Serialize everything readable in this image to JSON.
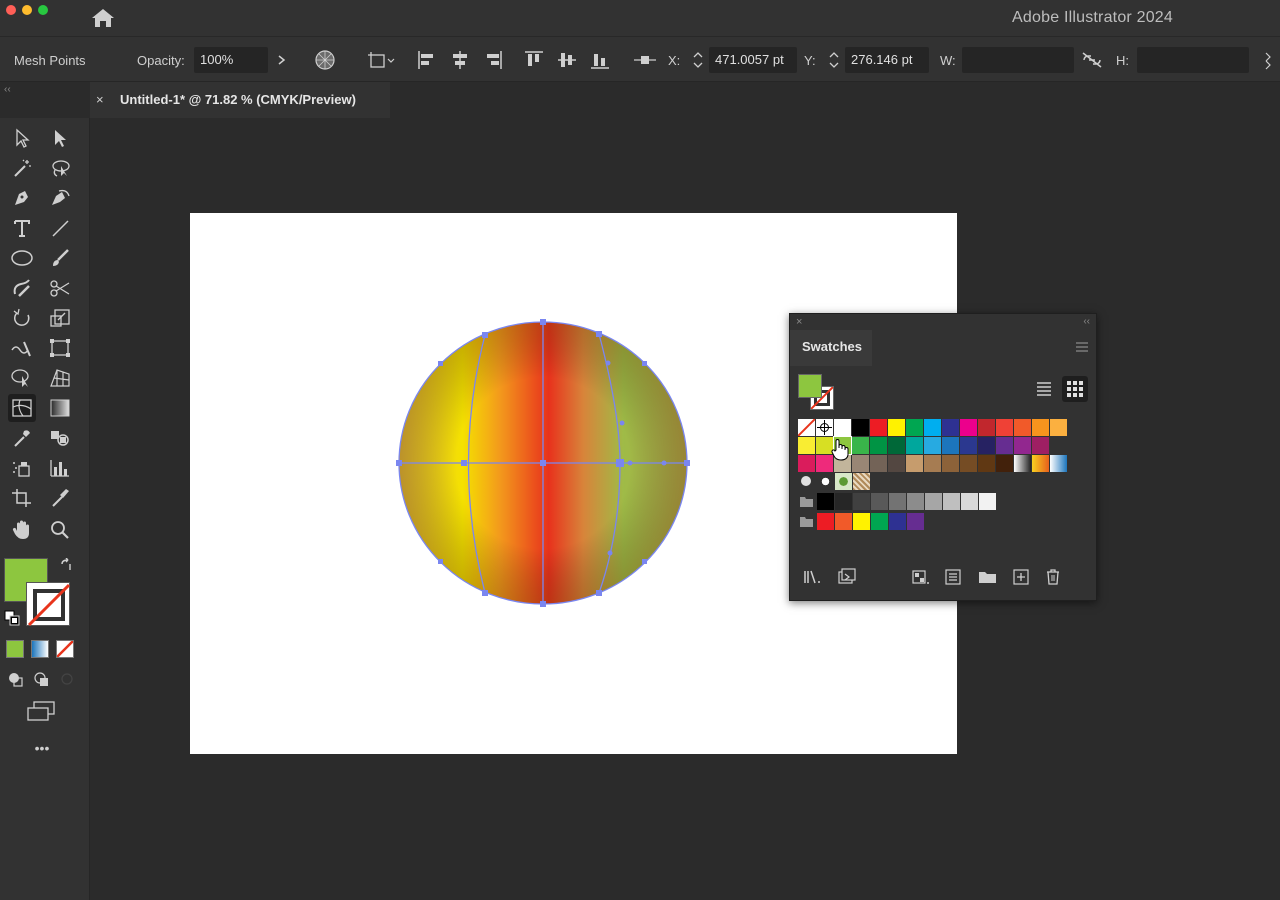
{
  "window": {
    "app_title": "Adobe Illustrator 2024"
  },
  "control_bar": {
    "selection_label": "Mesh Points",
    "opacity_label": "Opacity:",
    "opacity_value": "100%",
    "x_label": "X:",
    "x_value": "471.0057 pt",
    "y_label": "Y:",
    "y_value": "276.146 pt",
    "w_label": "W:",
    "h_label": "H:"
  },
  "document_tab": {
    "close_glyph": "×",
    "title": "Untitled-1* @ 71.82 % (CMYK/Preview)"
  },
  "toolbar": {
    "tools": [
      "selection",
      "direct-selection",
      "magic-wand",
      "lasso",
      "pen",
      "curvature",
      "type",
      "line-segment",
      "ellipse",
      "paintbrush",
      "shaper",
      "scissors",
      "rotate",
      "scale",
      "warp",
      "free-transform",
      "shape-builder",
      "perspective-grid",
      "mesh",
      "gradient",
      "eyedropper",
      "blend",
      "symbol-sprayer",
      "column-graph",
      "artboard",
      "slice",
      "hand",
      "zoom"
    ],
    "active_tool": "mesh",
    "fill_color": "#8dc63f",
    "stroke": "none",
    "more_glyph": "•••"
  },
  "canvas": {
    "object": "ellipse-with-gradient-mesh",
    "mesh_colors": [
      "#f4e000",
      "#e8341c",
      "#8fbf4a",
      "#e6b43a"
    ],
    "selection_color": "#7a86f0"
  },
  "swatches_panel": {
    "title": "Swatches",
    "close_glyph": "×",
    "collapse_glyph": "‹‹",
    "fill_color": "#8dc63f",
    "view_modes": [
      "list-view",
      "grid-view"
    ],
    "selected_view": "grid-view",
    "rows": [
      [
        "none",
        "registration",
        "#ffffff",
        "#000000",
        "#ed1c24",
        "#fff200",
        "#00a651",
        "#00aeef",
        "#2e3192",
        "#ec008c",
        "#c1272d",
        "#ef4136",
        "#f15a29",
        "#f7941d",
        "#fbb040"
      ],
      [
        "#f9ed32",
        "#d7df23",
        "#8dc63f",
        "#39b54a",
        "#009444",
        "#006838",
        "#00a79d",
        "#27aae1",
        "#1c75bc",
        "#2b388f",
        "#262262",
        "#662d91",
        "#92278f",
        "#9e1f63"
      ],
      [
        "#da1c5c",
        "#ee2a7b",
        "#c2b59b",
        "#998675",
        "#736357",
        "#534741",
        "#c69c6d",
        "#a67c52",
        "#8c6239",
        "#754c24",
        "#603813",
        "#42210b",
        "gradient-white-black",
        "gradient-orange",
        "gradient-blue"
      ],
      [
        "pattern-dots",
        "pattern-leaves",
        "pattern-texture"
      ],
      [
        "#000000",
        "#262626",
        "#404040",
        "#595959",
        "#737373",
        "#8c8c8c",
        "#a6a6a6",
        "#bfbfbf",
        "#d9d9d9",
        "#f2f2f2"
      ],
      [
        "#ed1c24",
        "#f15a29",
        "#fff200",
        "#00a651",
        "#2e3192",
        "#662d91"
      ]
    ],
    "footer_icons": [
      "swatch-libraries-menu",
      "place-swatches",
      "show-swatch-kinds",
      "swatch-options",
      "new-color-group",
      "new-swatch",
      "delete-swatch"
    ]
  }
}
